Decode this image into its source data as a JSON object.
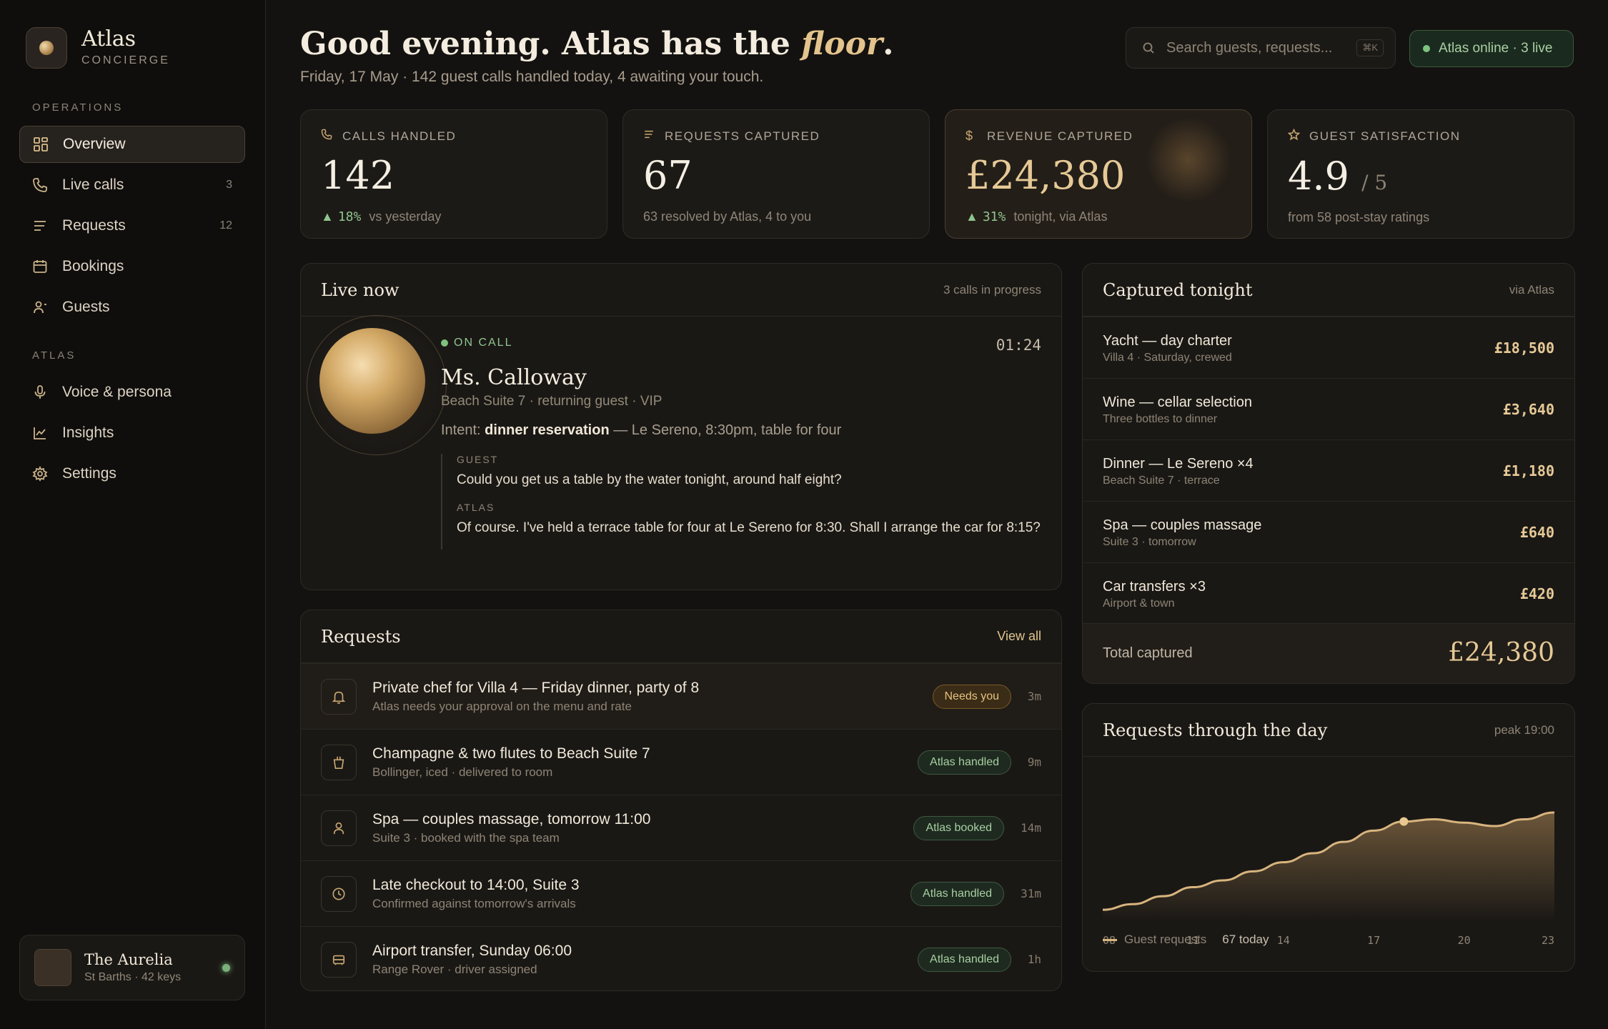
{
  "brand": {
    "name": "Atlas",
    "subtitle": "CONCIERGE"
  },
  "nav": {
    "operations_label": "OPERATIONS",
    "atlas_label": "ATLAS",
    "items": [
      {
        "label": "Overview",
        "icon": "grid-icon",
        "count": ""
      },
      {
        "label": "Live calls",
        "icon": "phone-icon",
        "count": "3"
      },
      {
        "label": "Requests",
        "icon": "list-icon",
        "count": "12"
      },
      {
        "label": "Bookings",
        "icon": "calendar-icon",
        "count": ""
      },
      {
        "label": "Guests",
        "icon": "guest-icon",
        "count": ""
      },
      {
        "label": "Voice & persona",
        "icon": "mic-icon",
        "count": ""
      },
      {
        "label": "Insights",
        "icon": "chart-icon",
        "count": ""
      },
      {
        "label": "Settings",
        "icon": "settings-icon",
        "count": ""
      }
    ]
  },
  "hotel": {
    "name": "The Aurelia",
    "sub": "St Barths · 42 keys"
  },
  "header": {
    "greeting_pre": "Good evening. Atlas has the ",
    "greeting_em": "floor",
    "greeting_post": ".",
    "subline": "Friday, 17 May · 142 guest calls handled today, 4 awaiting your touch.",
    "search_placeholder": "Search guests, requests...",
    "search_kbd": "⌘K",
    "status": "Atlas online · 3 live"
  },
  "stats": [
    {
      "label": "CALLS HANDLED",
      "value": "142",
      "delta": "18%",
      "note": "vs yesterday"
    },
    {
      "label": "REQUESTS CAPTURED",
      "value": "67",
      "delta": "",
      "note": "63 resolved by Atlas, 4 to you"
    },
    {
      "label": "REVENUE CAPTURED",
      "value": "£24,380",
      "delta": "31%",
      "note": "tonight, via Atlas"
    },
    {
      "label": "GUEST SATISFACTION",
      "value": "4.9",
      "unit": "/ 5",
      "delta": "",
      "note": "from 58 post-stay ratings"
    }
  ],
  "live": {
    "title": "Live now",
    "meta": "3 calls in progress",
    "status": "ON CALL",
    "timer": "01:24",
    "caller": "Ms. Calloway",
    "caller_sub": "Beach Suite 7 · returning guest · VIP",
    "intent_label": "Intent:",
    "intent_value": "dinner reservation",
    "intent_rest": " — Le Sereno, 8:30pm, table for four",
    "guest_label": "GUEST",
    "guest_line": "Could you get us a table by the water tonight, around half eight?",
    "atlas_label": "ATLAS",
    "atlas_line": "Of course. I've held a terrace table for four at Le Sereno for 8:30. Shall I arrange the car for 8:15?"
  },
  "requests": {
    "title": "Requests",
    "view_all": "View all",
    "items": [
      {
        "title": "Private chef for Villa 4 — Friday dinner, party of 8",
        "sub": "Atlas needs your approval on the menu and rate",
        "badge": "Needs you",
        "time": "3m",
        "icon": "bell-icon"
      },
      {
        "title": "Champagne & two flutes to Beach Suite 7",
        "sub": "Bollinger, iced · delivered to room",
        "badge": "Atlas handled",
        "time": "9m",
        "icon": "bucket-icon"
      },
      {
        "title": "Spa — couples massage, tomorrow 11:00",
        "sub": "Suite 3 · booked with the spa team",
        "badge": "Atlas booked",
        "time": "14m",
        "icon": "person-icon"
      },
      {
        "title": "Late checkout to 14:00, Suite 3",
        "sub": "Confirmed against tomorrow's arrivals",
        "badge": "Atlas handled",
        "time": "31m",
        "icon": "clock-icon"
      },
      {
        "title": "Airport transfer, Sunday 06:00",
        "sub": "Range Rover · driver assigned",
        "badge": "Atlas handled",
        "time": "1h",
        "icon": "car-icon"
      }
    ]
  },
  "captured": {
    "title": "Captured tonight",
    "meta": "via Atlas",
    "items": [
      {
        "title": "Yacht — day charter",
        "sub": "Villa 4 · Saturday, crewed",
        "amount": "£18,500"
      },
      {
        "title": "Wine — cellar selection",
        "sub": "Three bottles to dinner",
        "amount": "£3,640"
      },
      {
        "title": "Dinner — Le Sereno ×4",
        "sub": "Beach Suite 7 · terrace",
        "amount": "£1,180"
      },
      {
        "title": "Spa — couples massage",
        "sub": "Suite 3 · tomorrow",
        "amount": "£640"
      },
      {
        "title": "Car transfers ×3",
        "sub": "Airport & town",
        "amount": "£420"
      }
    ],
    "total_label": "Total captured",
    "total_value": "£24,380"
  },
  "chart_section": {
    "title": "Requests through the day",
    "meta": "peak 19:00",
    "legend": "Guest requests",
    "legend_value": "67 today"
  },
  "chart_data": {
    "type": "area",
    "x": [
      8,
      9,
      10,
      11,
      12,
      13,
      14,
      15,
      16,
      17,
      18,
      19,
      20,
      21,
      22,
      23
    ],
    "series": [
      {
        "name": "Guest requests",
        "values": [
          1.0,
          1.5,
          2.2,
          3.0,
          3.6,
          4.4,
          5.2,
          6.0,
          7.0,
          8.0,
          8.8,
          9.0,
          8.7,
          8.4,
          9.0,
          9.6
        ]
      }
    ],
    "xticks": [
      "08",
      "11",
      "14",
      "17",
      "20",
      "23"
    ],
    "highlight_x": 18,
    "ylim": [
      0,
      12
    ],
    "colors": {
      "line": "#d8b47e",
      "dot": "#e8c890"
    }
  }
}
